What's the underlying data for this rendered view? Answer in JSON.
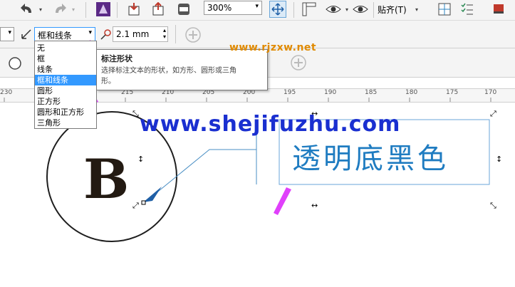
{
  "toolbar": {
    "zoom_value": "300%",
    "snap_label": "贴齐(T)"
  },
  "property_bar": {
    "border_style_selected": "框和线条",
    "leader_width": "2.1 mm"
  },
  "dropdown": {
    "items": [
      "无",
      "框",
      "线条",
      "框和线条",
      "圆形",
      "正方形",
      "圆形和正方形",
      "三角形"
    ],
    "selected_index": 3
  },
  "tooltip": {
    "title": "标注形状",
    "description_line1": "选择标注文本的形状，如方形、圆形或三角",
    "description_line2": "形。"
  },
  "watermarks": {
    "site1": "www.rjzxw.net",
    "site2": "www.shejifuzhu.com"
  },
  "ruler": {
    "labels": [
      "230",
      "215",
      "210",
      "205",
      "200",
      "195",
      "190",
      "185",
      "180",
      "175",
      "170"
    ]
  },
  "canvas": {
    "circle_letter": "B",
    "callout_text": "透明底黑色"
  },
  "colors": {
    "callout_line": "#2e86c1",
    "callout_text": "#1f7cc1",
    "arrow_annotation": "#e040fb",
    "selection_box": "#6aa6d8"
  }
}
